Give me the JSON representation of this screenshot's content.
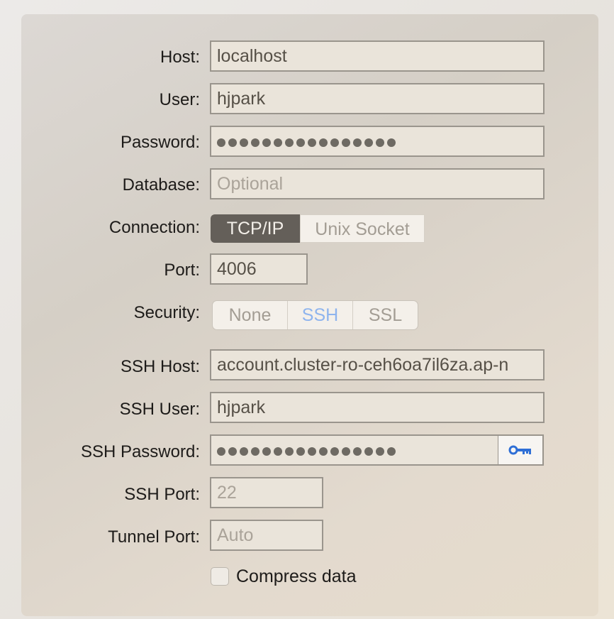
{
  "form": {
    "host": {
      "label": "Host:",
      "value": "localhost"
    },
    "user": {
      "label": "User:",
      "value": "hjpark"
    },
    "password": {
      "label": "Password:",
      "masked_length": 16
    },
    "database": {
      "label": "Database:",
      "placeholder": "Optional"
    },
    "connection": {
      "label": "Connection:",
      "options": [
        "TCP/IP",
        "Unix Socket"
      ],
      "selected": "TCP/IP"
    },
    "port": {
      "label": "Port:",
      "value": "4006"
    },
    "security": {
      "label": "Security:",
      "options": [
        "None",
        "SSH",
        "SSL"
      ],
      "selected": "SSH"
    },
    "ssh_host": {
      "label": "SSH Host:",
      "value": "account.cluster-ro-ceh6oa7il6za.ap-n"
    },
    "ssh_user": {
      "label": "SSH User:",
      "value": "hjpark"
    },
    "ssh_password": {
      "label": "SSH Password:",
      "masked_length": 16,
      "key_icon": "key-icon"
    },
    "ssh_port": {
      "label": "SSH Port:",
      "placeholder": "22"
    },
    "tunnel_port": {
      "label": "Tunnel Port:",
      "placeholder": "Auto"
    },
    "compress": {
      "label": "Compress data",
      "checked": false
    }
  },
  "colors": {
    "accent": "#2f6fd6",
    "selected_segment": "#645f59",
    "ssh_selected_text": "#8eb4ee"
  }
}
